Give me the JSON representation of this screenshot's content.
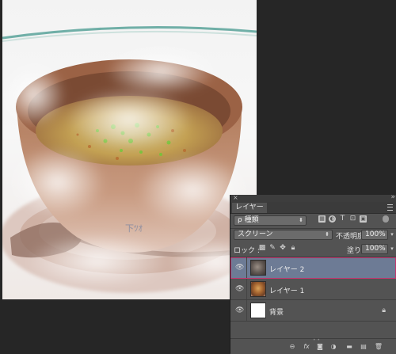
{
  "panel": {
    "title": "レイヤー",
    "close_glyph": "×",
    "collapse_glyph": "»",
    "filter": {
      "kind_label": "種類",
      "search_glyph": "ρ"
    },
    "blend_mode": "スクリーン",
    "opacity_label": "不透明度:",
    "opacity_value": "100%",
    "lock_label": "ロック :",
    "fill_label": "塗り:",
    "fill_value": "100%",
    "layers": [
      {
        "name": "レイヤー 2",
        "selected": true,
        "visible": true,
        "locked": false
      },
      {
        "name": "レイヤー 1",
        "selected": false,
        "visible": true,
        "locked": false
      },
      {
        "name": "背景",
        "selected": false,
        "visible": true,
        "locked": true
      }
    ],
    "footer_icons": [
      "link-icon",
      "fx-icon",
      "mask-icon",
      "adjustment-icon",
      "folder-icon",
      "new-layer-icon",
      "trash-icon"
    ]
  },
  "colors": {
    "panel_bg": "#535353",
    "selected_layer_bg": "#6d7b95",
    "selected_outline": "#c2376e",
    "app_bg": "#262626"
  }
}
